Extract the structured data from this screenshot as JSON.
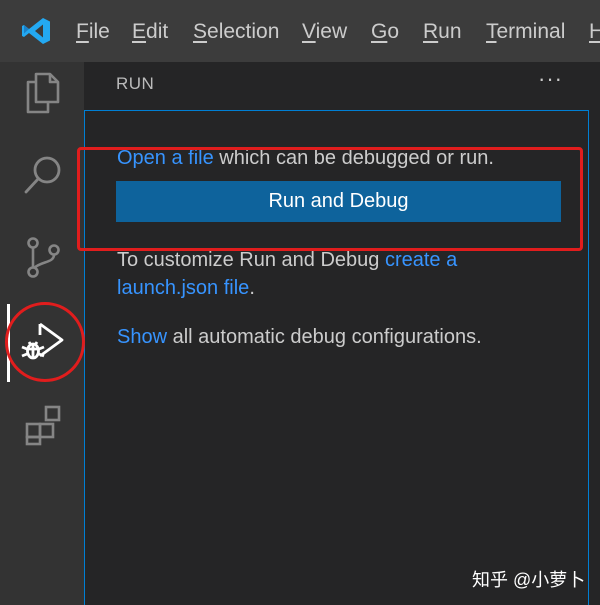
{
  "menu": {
    "items": [
      {
        "mnemonic": "F",
        "rest": "ile"
      },
      {
        "mnemonic": "E",
        "rest": "dit"
      },
      {
        "mnemonic": "S",
        "rest": "election"
      },
      {
        "mnemonic": "V",
        "rest": "iew"
      },
      {
        "mnemonic": "G",
        "rest": "o"
      },
      {
        "mnemonic": "R",
        "rest": "un"
      },
      {
        "mnemonic": "T",
        "rest": "erminal"
      },
      {
        "mnemonic": "H",
        "rest": ""
      }
    ]
  },
  "activity_bar": {
    "icons": [
      "files-icon",
      "search-icon",
      "source-control-icon",
      "run-debug-icon",
      "extensions-icon"
    ],
    "active": "run-debug-icon"
  },
  "sidebar": {
    "title": "RUN",
    "more_actions": "···",
    "open_file": {
      "link": "Open a file",
      "text": " which can be debugged or run."
    },
    "run_button_label": "Run and Debug",
    "customize": {
      "text": "To customize Run and Debug ",
      "link1": "create a",
      "link2": "launch.json file",
      "period": "."
    },
    "show": {
      "link": "Show",
      "text": " all automatic debug configurations."
    }
  },
  "watermark": "知乎 @小萝卜",
  "colors": {
    "menubar_bg": "#3c3c3c",
    "activitybar_bg": "#333333",
    "sidebar_bg": "#252526",
    "button_bg": "#0e639c",
    "link": "#3794ff",
    "focus_border": "#007fd4",
    "annotation": "#e11d1d"
  }
}
